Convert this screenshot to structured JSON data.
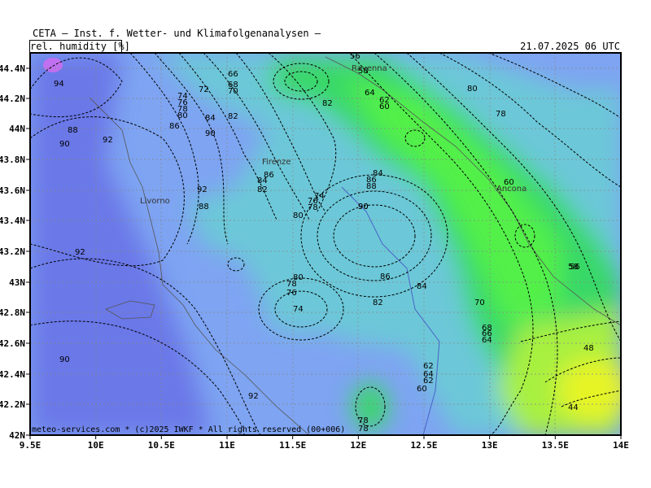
{
  "header": {
    "title": "CETA — Inst. f. Wetter- und Klimafolgenanalysen —",
    "parameter": "rel. humidity [%]",
    "datetime": "21.07.2025 06 UTC"
  },
  "map": {
    "lon_range": [
      9.5,
      14.0
    ],
    "lat_range": [
      42.0,
      44.5
    ],
    "x_ticks": [
      "9.5E",
      "10E",
      "10.5E",
      "11E",
      "11.5E",
      "12E",
      "12.5E",
      "13E",
      "13.5E",
      "14E"
    ],
    "y_ticks": [
      "44.4N",
      "44.2N",
      "44N",
      "43.8N",
      "43.6N",
      "43.4N",
      "43.2N",
      "43N",
      "42.8N",
      "42.6N",
      "42.4N",
      "42.2N",
      "42N"
    ],
    "grid": "dotted",
    "colors": {
      "very_humid": "#6a78e8",
      "humid": "#7ea4f2",
      "moderate": "#6cc8d8",
      "green": "#38d868",
      "bright_green": "#52f04a",
      "dry": "#a8f040",
      "driest": "#e6f428",
      "peak": "#c070f0"
    },
    "cities": [
      "Ravenna",
      "Firenze",
      "Livorno",
      "Ancona"
    ],
    "contour_labels": [
      "94",
      "88",
      "90",
      "92",
      "72",
      "74",
      "76",
      "78",
      "80",
      "86",
      "84",
      "82",
      "66",
      "68",
      "70",
      "56",
      "64",
      "62",
      "60",
      "58",
      "48",
      "44",
      "78",
      "82",
      "80",
      "92",
      "90",
      "84",
      "86",
      "88",
      "90",
      "88",
      "86",
      "84",
      "82",
      "76",
      "74",
      "90",
      "92",
      "86",
      "84",
      "82",
      "80",
      "78",
      "76",
      "74",
      "80",
      "78",
      "70",
      "68",
      "66",
      "64",
      "62",
      "64",
      "62",
      "60",
      "78",
      "78",
      "92",
      "90",
      "60",
      "58",
      "56"
    ],
    "credit": "meteo-services.com * (c)2025 IWKF * All rights reserved (00+006)"
  }
}
